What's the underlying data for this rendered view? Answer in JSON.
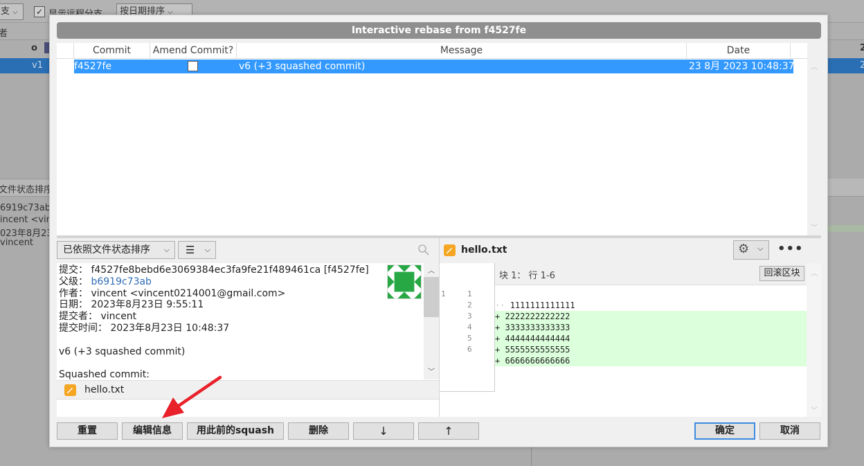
{
  "background": {
    "branch_dropdown": "支",
    "show_remote_label": "显示远程分支",
    "sort_dropdown": "按日期排序",
    "header_left": "者",
    "row1_mark": "o",
    "row1_right": "2",
    "selected_row_label": "v1",
    "selected_row_right": "2",
    "left_panel_header": "文件状态排序",
    "left_lines": [
      "6919c73ab",
      "incent <vin",
      "023年8月23",
      "vincent"
    ]
  },
  "dialog": {
    "title": "Interactive rebase from f4527fe",
    "columns": {
      "commit": "Commit",
      "amend": "Amend Commit?",
      "message": "Message",
      "date": "Date"
    },
    "rows": [
      {
        "commit": "f4527fe",
        "amend": false,
        "message": "v6 (+3 squashed commit)",
        "date": "23 8月 2023 10:48:37"
      }
    ],
    "left": {
      "sort_dropdown": "已依照文件状态排序",
      "list_icon": "list-icon",
      "info": {
        "commit_label": "提交：",
        "commit_value": "f4527fe8bebd6e3069384ec3fa9fe21f489461ca [f4527fe]",
        "parent_label": "父级：",
        "parent_value": "b6919c73ab",
        "author_label": "作者：",
        "author_value": "vincent <vincent0214001@gmail.com>",
        "date_label": "日期：",
        "date_value": "2023年8月23日 9:55:11",
        "committer_label": "提交者：",
        "committer_value": "vincent",
        "commit_time_label": "提交时间：",
        "commit_time_value": "2023年8月23日 10:48:37",
        "message": "v6 (+3 squashed commit)",
        "squashed": "Squashed commit:"
      },
      "file": "hello.txt"
    },
    "right": {
      "file": "hello.txt",
      "hunk_header": "块 1： 行 1-6",
      "rollback_button": "回滚区块",
      "lines": [
        {
          "old": "1",
          "new": "1",
          "sign": " ",
          "text": "1111111111111",
          "added": false
        },
        {
          "old": "",
          "new": "2",
          "sign": "+",
          "text": "2222222222222",
          "added": true
        },
        {
          "old": "",
          "new": "3",
          "sign": "+",
          "text": "3333333333333",
          "added": true
        },
        {
          "old": "",
          "new": "4",
          "sign": "+",
          "text": "4444444444444",
          "added": true
        },
        {
          "old": "",
          "new": "5",
          "sign": "+",
          "text": "5555555555555",
          "added": true
        },
        {
          "old": "",
          "new": "6",
          "sign": "+",
          "text": "6666666666666",
          "added": true
        }
      ]
    },
    "buttons": {
      "reset": "重置",
      "edit_message": "编辑信息",
      "squash_previous": "用此前的squash",
      "delete": "删除",
      "down": "↓",
      "up": "↑",
      "ok": "确定",
      "cancel": "取消"
    }
  },
  "colors": {
    "selection": "#3399ff",
    "added_line": "#dcffdc",
    "annotation_arrow": "#e8212b"
  }
}
